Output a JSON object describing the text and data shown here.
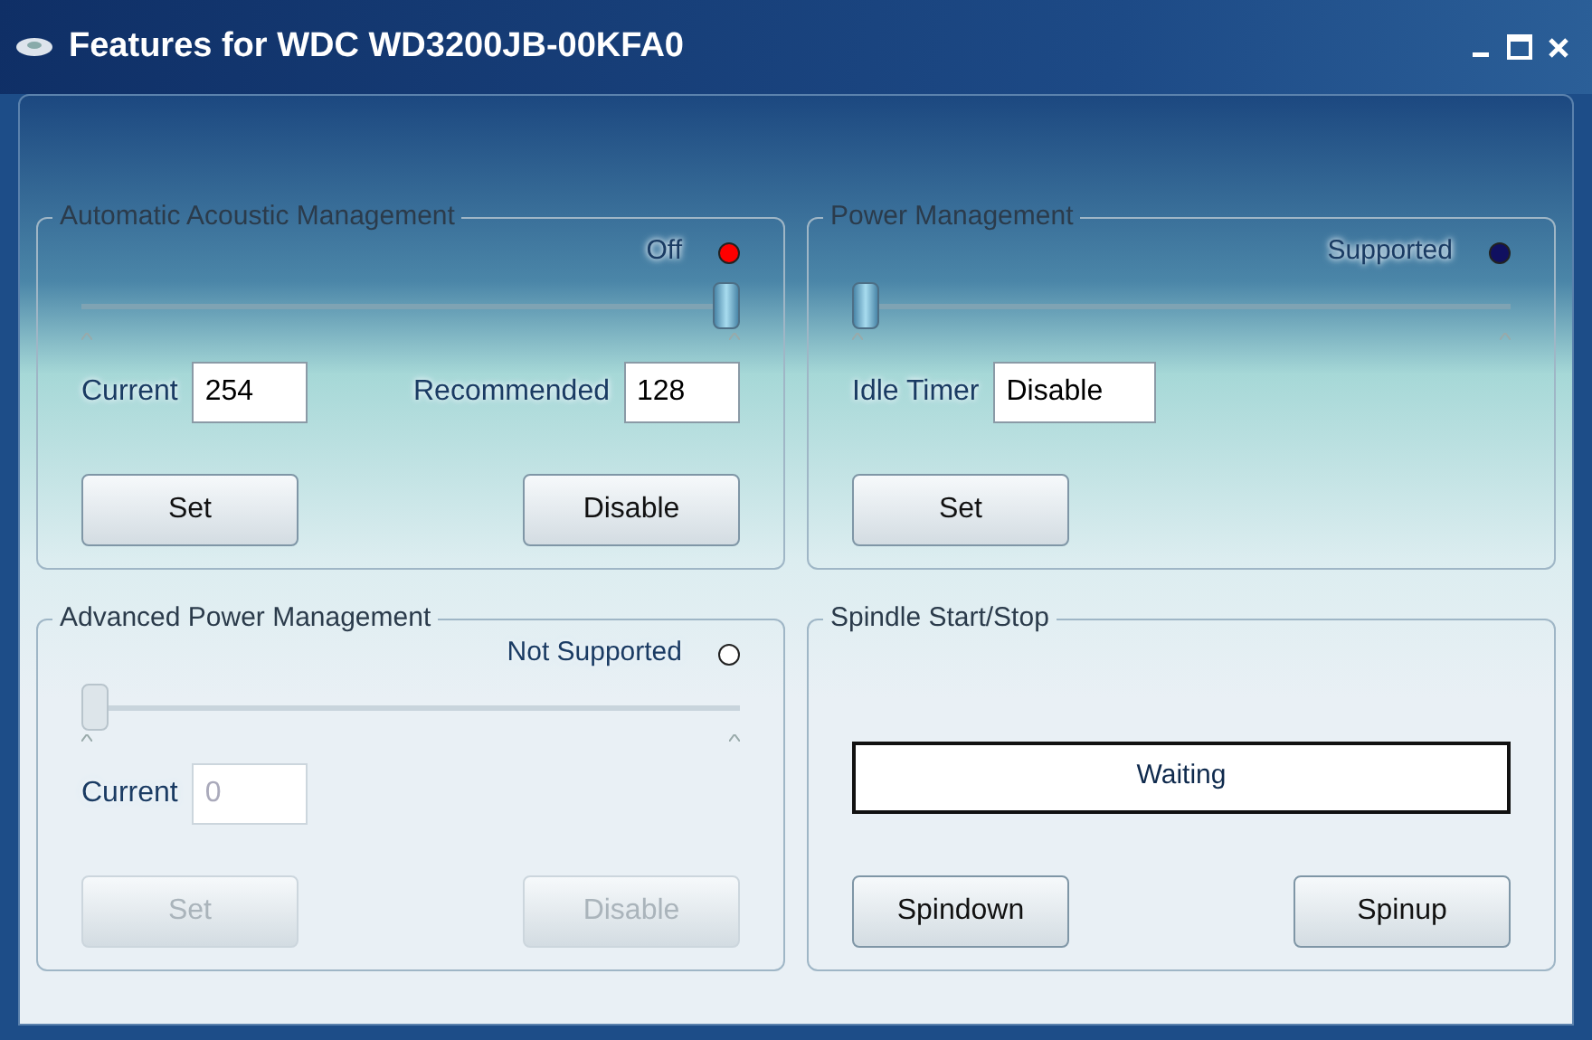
{
  "window": {
    "title": "Features for WDC WD3200JB-00KFA0"
  },
  "groups": [
    {
      "title": "Automatic Acoustic Management",
      "disabled": false,
      "status": {
        "text": "Off",
        "color": "#ff0000"
      },
      "slider": {
        "level": 1
      },
      "fields": [
        {
          "label": "Current",
          "value": "254"
        },
        {
          "label": "Recommended",
          "value": "128"
        }
      ],
      "buttons": [
        "Set",
        "Disable"
      ]
    },
    {
      "title": "Power Management",
      "disabled": false,
      "status": {
        "text": "Supported",
        "color": "#101060"
      },
      "slider": {
        "level": 0
      },
      "fields": [
        {
          "label": "Idle Timer",
          "value": "Disable"
        }
      ],
      "buttons": [
        "Set"
      ]
    },
    {
      "title": "Advanced Power Management",
      "disabled": true,
      "status": {
        "text": "Not Supported",
        "color": "#ffffff"
      },
      "slider": {
        "level": 0
      },
      "fields": [
        {
          "label": "Current",
          "value": "0"
        }
      ],
      "buttons": [
        "Set",
        "Disable"
      ]
    },
    {
      "title": "Spindle Start/Stop",
      "disabled": false,
      "progress": {
        "text": "Waiting"
      },
      "buttons": [
        "Spindown",
        "Spinup"
      ]
    }
  ]
}
